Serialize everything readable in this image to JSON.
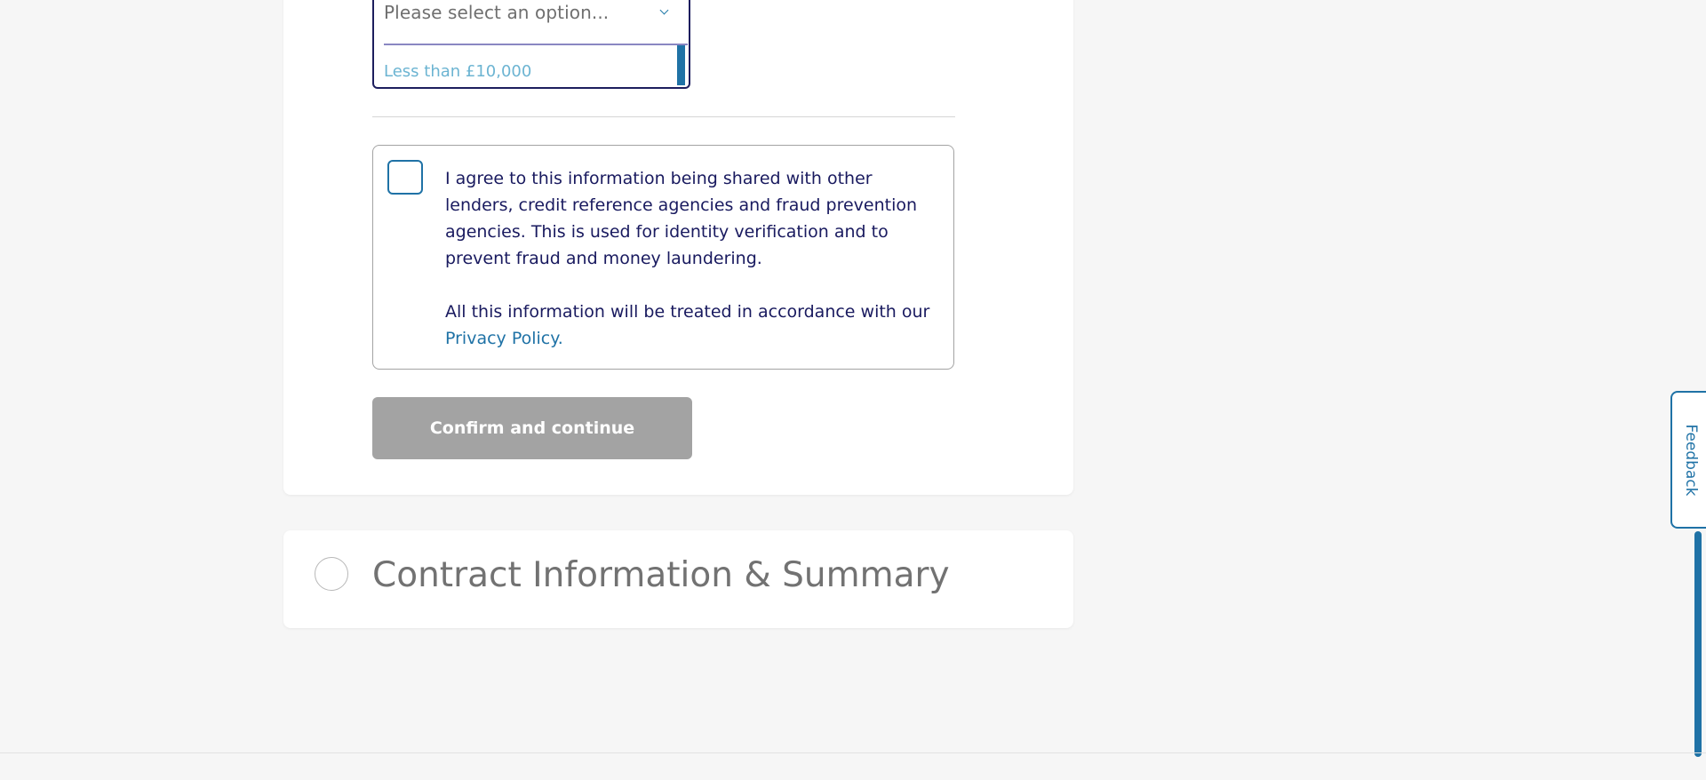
{
  "income_dropdown": {
    "placeholder": "Please select an option...",
    "options": [
      "Less than £10,000"
    ]
  },
  "consent": {
    "checked": false,
    "text": "I agree to this information being shared with other lenders, credit reference agencies and fraud prevention agencies. This is used for identity verification and to prevent fraud and money laundering.",
    "privacy_prefix": "All this information will be treated in accordance with our",
    "privacy_link": "Privacy Policy."
  },
  "confirm_button": {
    "label": "Confirm and continue"
  },
  "next_step": {
    "title": "Contract Information & Summary"
  },
  "feedback": {
    "label": "Feedback"
  },
  "colors": {
    "accent": "#1f72a6",
    "text_navy": "#191a5f",
    "disabled_button": "#a3a3a3",
    "page_background": "#f6f6f6"
  },
  "icons": {
    "dropdown": "chevron-down-icon",
    "step_status": "empty-circle-icon"
  }
}
